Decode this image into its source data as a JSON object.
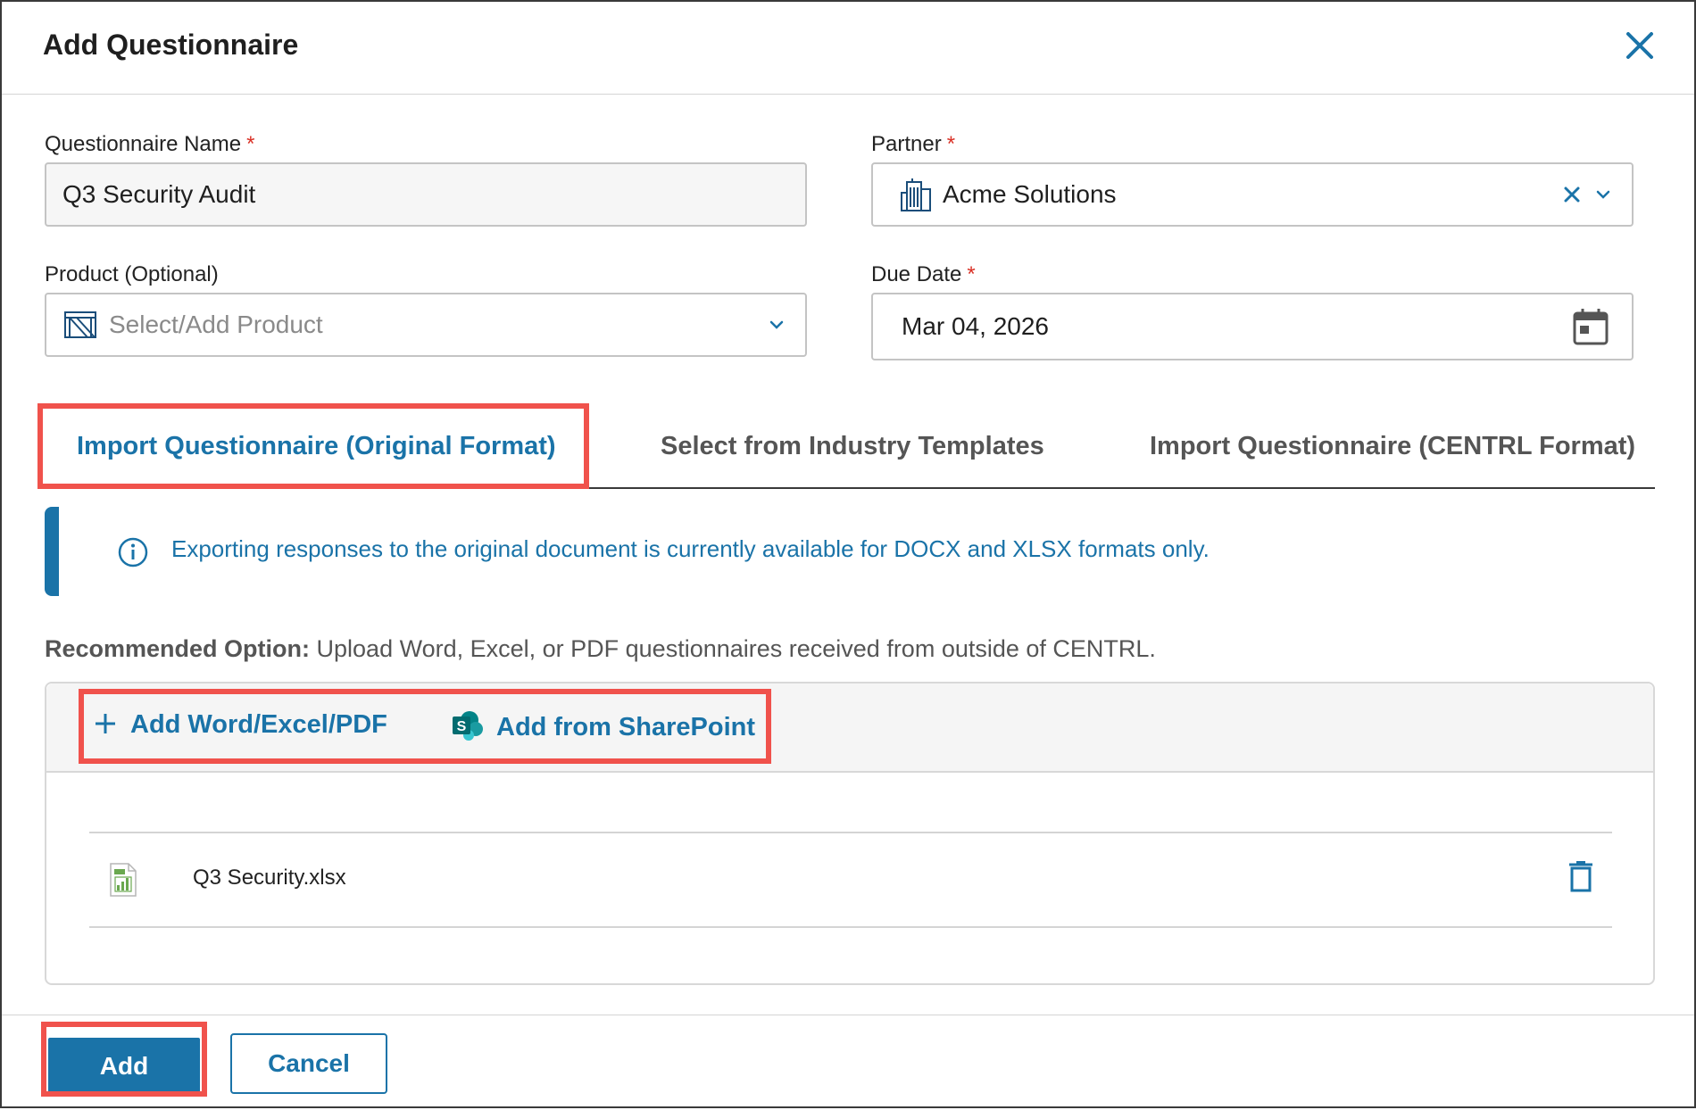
{
  "dialog": {
    "title": "Add Questionnaire",
    "close_icon": "close-icon"
  },
  "form": {
    "questionnaire_name": {
      "label": "Questionnaire Name",
      "required": "*",
      "value": "Q3 Security Audit"
    },
    "partner": {
      "label": "Partner",
      "required": "*",
      "value": "Acme Solutions",
      "icon": "building-icon"
    },
    "product": {
      "label": "Product (Optional)",
      "placeholder": "Select/Add Product",
      "icon": "product-icon"
    },
    "due_date": {
      "label": "Due Date",
      "required": "*",
      "value": "Mar 04, 2026",
      "icon": "calendar-icon"
    }
  },
  "tabs": [
    {
      "label": "Import Questionnaire (Original Format)",
      "active": true
    },
    {
      "label": "Select from Industry Templates",
      "active": false
    },
    {
      "label": "Import Questionnaire (CENTRL Format)",
      "active": false
    }
  ],
  "info": {
    "text": "Exporting responses to the original document is currently available for DOCX and XLSX formats only."
  },
  "recommended": {
    "bold": "Recommended Option:",
    "text": " Upload Word, Excel, or PDF questionnaires received from outside of CENTRL."
  },
  "upload": {
    "add_file_label": "Add Word/Excel/PDF",
    "sharepoint_label": "Add from SharePoint",
    "files": [
      {
        "name": "Q3 Security.xlsx",
        "icon": "excel-file-icon"
      }
    ]
  },
  "footer": {
    "add_label": "Add",
    "cancel_label": "Cancel"
  },
  "colors": {
    "accent": "#1a73a8",
    "required": "#d93025",
    "highlight": "#f0524c",
    "sharepoint": "#0b7f7a"
  }
}
